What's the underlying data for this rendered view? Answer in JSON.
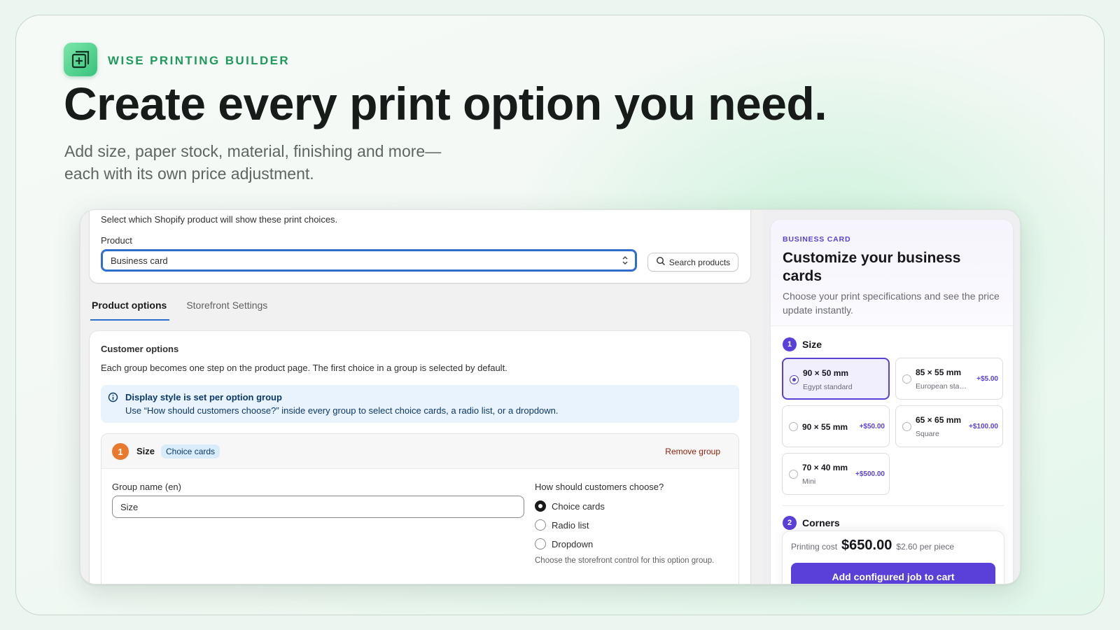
{
  "hero": {
    "brand": "WISE PRINTING BUILDER",
    "headline": "Create every print option you need.",
    "subline_1": "Add size, paper stock, material, finishing and more—",
    "subline_2": "each with its own price adjustment."
  },
  "product_card": {
    "description": "Select which Shopify product will show these print choices.",
    "product_label": "Product",
    "product_value": "Business card",
    "search_label": "Search products"
  },
  "tabs": [
    {
      "label": "Product options",
      "active": true
    },
    {
      "label": "Storefront Settings",
      "active": false
    }
  ],
  "customer_options": {
    "title": "Customer options",
    "description": "Each group becomes one step on the product page. The first choice in a group is selected by default.",
    "banner_title": "Display style is set per option group",
    "banner_text": "Use “How should customers choose?” inside every group to select choice cards, a radio list, or a dropdown.",
    "group": {
      "number": "1",
      "name": "Size",
      "chip": "Choice cards",
      "remove_label": "Remove group",
      "field_label": "Group name (en)",
      "field_value": "Size",
      "choose_label": "How should customers choose?",
      "choices": [
        {
          "label": "Choice cards",
          "selected": true
        },
        {
          "label": "Radio list",
          "selected": false
        },
        {
          "label": "Dropdown",
          "selected": false
        }
      ],
      "help": "Choose the storefront control for this option group."
    }
  },
  "preview": {
    "eyebrow": "BUSINESS CARD",
    "title": "Customize your business cards",
    "subtitle": "Choose your print specifications and see the price update instantly.",
    "step1": {
      "number": "1",
      "label": "Size"
    },
    "options": [
      {
        "name": "90 × 50 mm",
        "sub": "Egypt standard",
        "price": "",
        "selected": true
      },
      {
        "name": "85 × 55 mm",
        "sub": "European standard",
        "price": "+$5.00",
        "selected": false
      },
      {
        "name": "90 × 55 mm",
        "sub": "",
        "price": "+$50.00",
        "selected": false
      },
      {
        "name": "65 × 65 mm",
        "sub": "Square",
        "price": "+$100.00",
        "selected": false
      },
      {
        "name": "70 × 40 mm",
        "sub": "Mini",
        "price": "+$500.00",
        "selected": false
      }
    ],
    "step2": {
      "number": "2",
      "label": "Corners"
    },
    "cost_label": "Printing cost",
    "cost_value": "$650.00",
    "cost_per": "$2.60 per piece",
    "cart_button": "Add configured job to cart"
  },
  "colors": {
    "brand_green": "#1f9a5b",
    "admin_blue": "#2c6ecb",
    "preview_purple": "#5b3fd9",
    "badge_orange": "#e8792f",
    "remove_red": "#8e1f0b"
  },
  "icons": [
    "plus-square-logo-icon",
    "chevron-updown-icon",
    "search-icon",
    "info-icon"
  ]
}
